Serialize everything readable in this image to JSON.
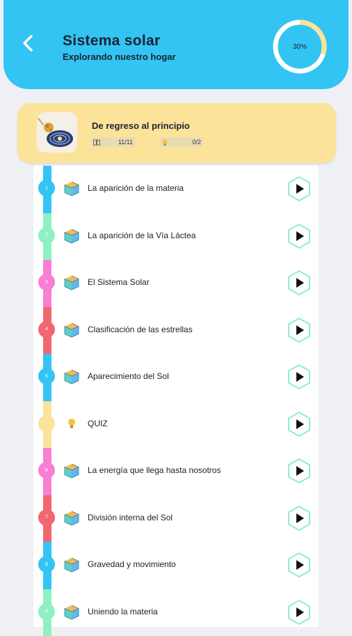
{
  "header": {
    "title": "Sistema solar",
    "subtitle": "Explorando nuestro hogar",
    "progress_label": "30%",
    "progress_fraction": 0.3,
    "accent": "#33c4f3"
  },
  "chapter": {
    "title": "De regreso al principio",
    "lessons_count": "11/11",
    "quiz_count": "0/2"
  },
  "lessons": [
    {
      "number": "1",
      "label": "La aparición de la materia",
      "icon": "dice-3d-icon",
      "color": "#33c4f3"
    },
    {
      "number": "2",
      "label": "La aparición de la Vía Láctea",
      "icon": "dice-3d-icon",
      "color": "#8ff0c4"
    },
    {
      "number": "3",
      "label": "El Sistema Solar",
      "icon": "dice-3d-icon",
      "color": "#f87fd4"
    },
    {
      "number": "4",
      "label": "Clasificación de las estrellas",
      "icon": "dice-3d-icon",
      "color": "#f2676f"
    },
    {
      "number": "5",
      "label": "Aparecimiento del Sol",
      "icon": "dice-3d-icon",
      "color": "#33c4f3"
    },
    {
      "number": "",
      "label": "QUIZ",
      "icon": "lightbulb-icon",
      "color": "#fbe39a"
    },
    {
      "number": "6",
      "label": "La energía que llega hasta nosotros",
      "icon": "dice-3d-icon",
      "color": "#f87fd4"
    },
    {
      "number": "7",
      "label": "División interna del Sol",
      "icon": "dice-3d-icon",
      "color": "#f2676f"
    },
    {
      "number": "8",
      "label": "Gravedad y movimiento",
      "icon": "dice-3d-icon",
      "color": "#33c4f3"
    },
    {
      "number": "9",
      "label": "Uniendo la materia",
      "icon": "dice-3d-icon",
      "color": "#8ff0c4"
    }
  ]
}
